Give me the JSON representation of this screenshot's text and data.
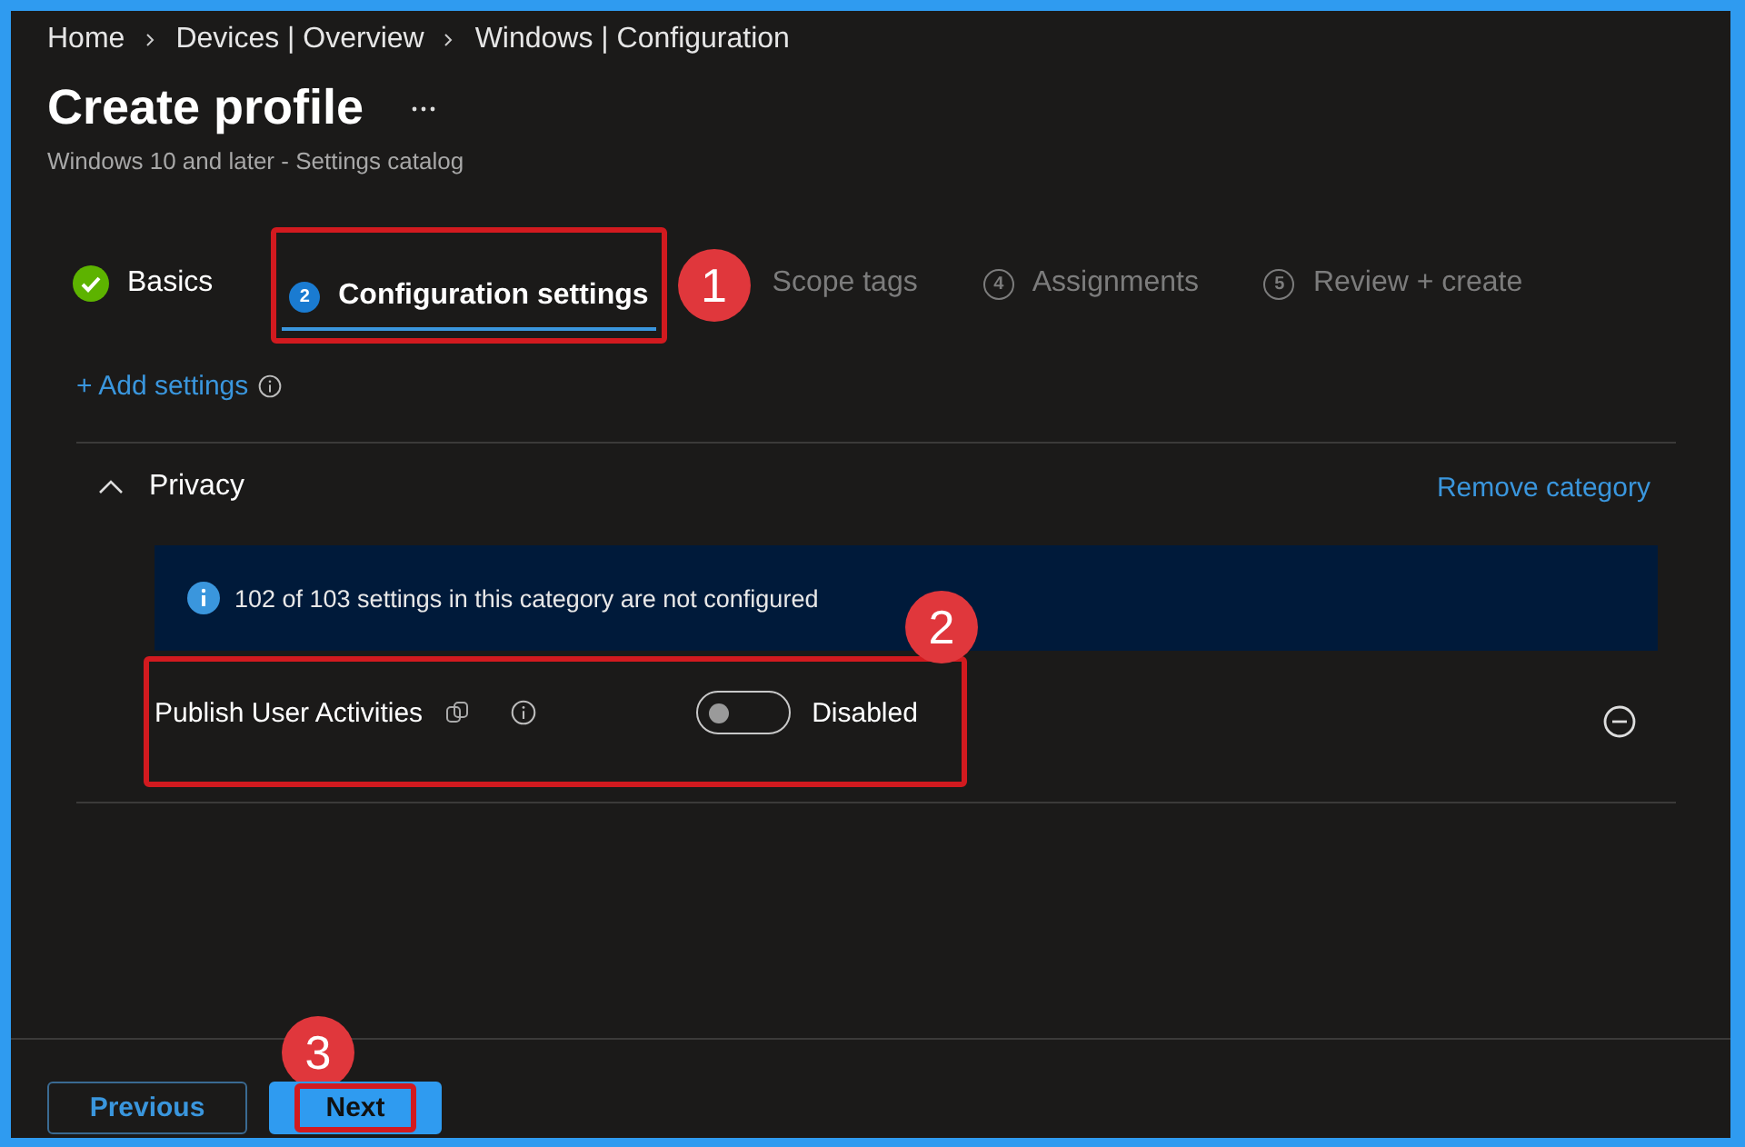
{
  "breadcrumb": [
    "Home",
    "Devices | Overview",
    "Windows | Configuration"
  ],
  "title": "Create profile",
  "subtitle": "Windows 10 and later - Settings catalog",
  "steps": [
    {
      "kind": "done",
      "label": "Basics",
      "selected": false
    },
    {
      "kind": "current",
      "number": "2",
      "label": "Configuration settings",
      "selected": true,
      "callout": "1"
    },
    {
      "kind": "upcoming",
      "label": "Scope tags",
      "selected": false
    },
    {
      "kind": "upcoming",
      "number": "4",
      "label": "Assignments",
      "selected": false
    },
    {
      "kind": "upcoming",
      "number": "5",
      "label": "Review + create",
      "selected": false
    }
  ],
  "add_settings": "+ Add settings",
  "category": {
    "name": "Privacy",
    "expanded": true,
    "action": "Remove category",
    "notice": "102 of 103 settings in this category are not configured",
    "settings": [
      {
        "name": "Publish User Activities",
        "on": false,
        "value": "Disabled",
        "callout": "2"
      }
    ]
  },
  "footer": {
    "buttons": [
      {
        "kind": "secondary",
        "label": "Previous"
      },
      {
        "kind": "primary",
        "label": "Next",
        "callout": "3"
      }
    ]
  }
}
